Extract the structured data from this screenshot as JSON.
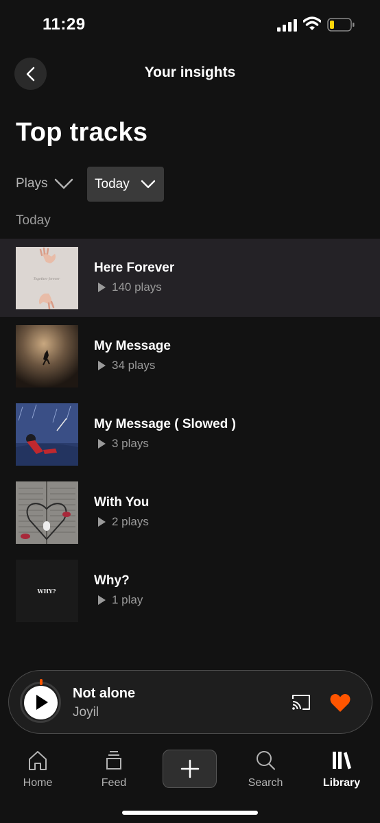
{
  "status_bar": {
    "time": "11:29"
  },
  "header": {
    "title": "Your insights"
  },
  "page_title": "Top tracks",
  "filters": {
    "metric": "Plays",
    "period": "Today"
  },
  "section_label": "Today",
  "tracks": [
    {
      "title": "Here Forever",
      "plays": "140 plays",
      "art_text": "Together forever"
    },
    {
      "title": "My Message",
      "plays": "34 plays"
    },
    {
      "title": "My Message ( Slowed )",
      "plays": "3 plays"
    },
    {
      "title": "With You",
      "plays": "2 plays"
    },
    {
      "title": "Why?",
      "plays": "1 play",
      "art_text": "WHY?"
    }
  ],
  "now_playing": {
    "title": "Not alone",
    "artist": "Joyil"
  },
  "nav": {
    "home": "Home",
    "feed": "Feed",
    "search": "Search",
    "library": "Library"
  },
  "colors": {
    "accent": "#ff5500",
    "background": "#121212",
    "battery": "#ffd60a"
  }
}
